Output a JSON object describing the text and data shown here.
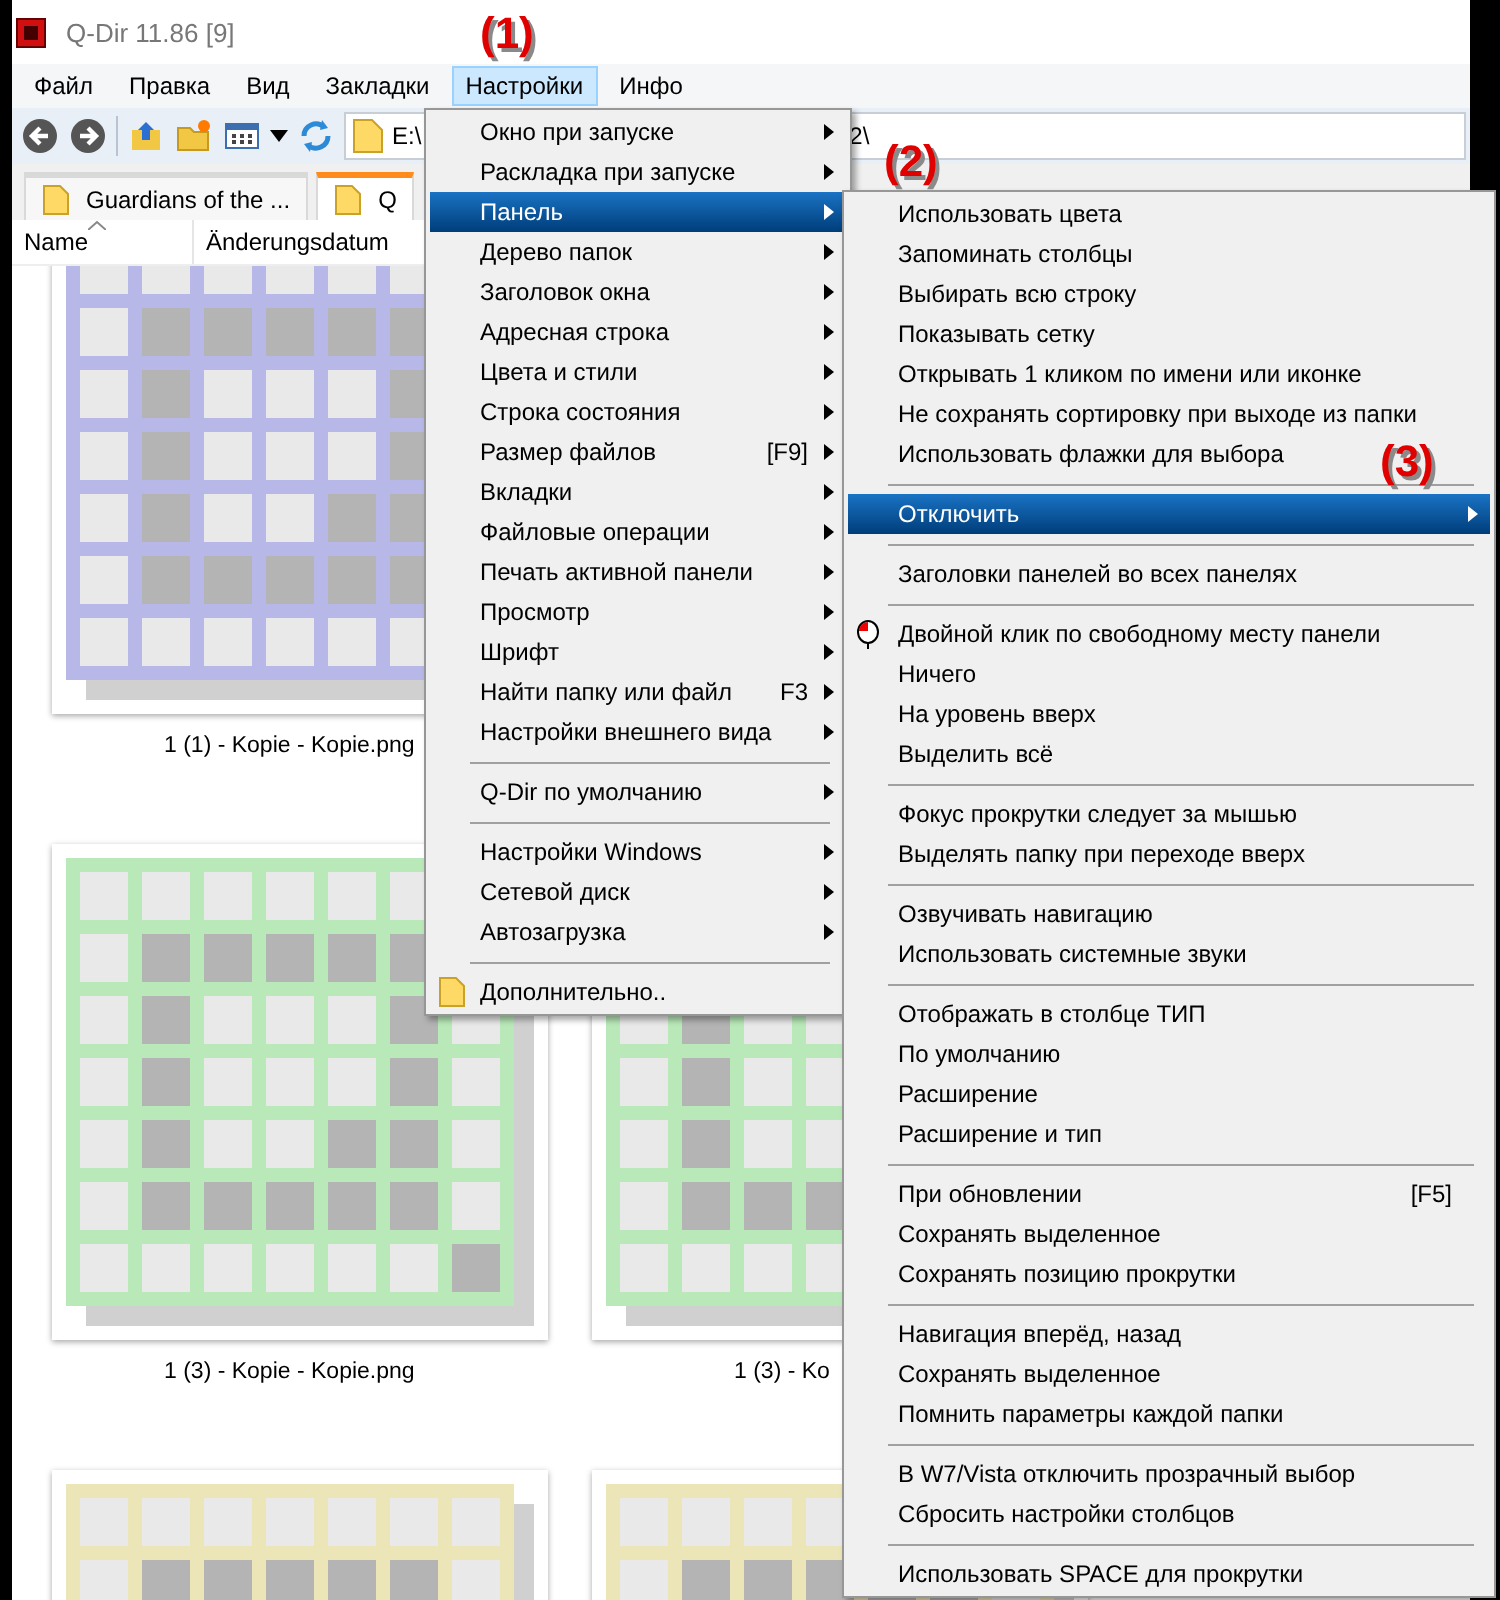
{
  "window": {
    "title": "Q-Dir 11.86 [9]"
  },
  "menu_bar": [
    {
      "label": "Файл",
      "selected": false
    },
    {
      "label": "Правка",
      "selected": false
    },
    {
      "label": "Вид",
      "selected": false
    },
    {
      "label": "Закладки",
      "selected": false
    },
    {
      "label": "Настройки",
      "selected": true
    },
    {
      "label": "Инфо",
      "selected": false
    }
  ],
  "address": {
    "value": "E:\\",
    "tail": "2\\"
  },
  "tabs": [
    {
      "label": "Guardians of the ...",
      "selected": false
    },
    {
      "label": "Q",
      "selected": true
    }
  ],
  "columns": [
    "Name",
    "Änderungsdatum"
  ],
  "thumbnail_rows": [
    [
      {
        "label": "1 (1) - Kopie - Kopie.png",
        "color": "#b8b8e8"
      }
    ],
    [
      {
        "label": "1 (3) - Kopie - Kopie.png",
        "color": "#b9e9b9"
      },
      {
        "label": "1 (3) - Ko",
        "color": "#b9e9b9"
      }
    ],
    [
      {
        "color": "#ebe5b8"
      },
      {
        "color": "#ebe5b8"
      }
    ]
  ],
  "settings_menu": [
    {
      "kind": "submenu",
      "label": "Окно при запуске",
      "selected": false
    },
    {
      "kind": "submenu",
      "label": "Раскладка при запуске",
      "selected": false
    },
    {
      "kind": "submenu",
      "label": "Панель",
      "selected": true
    },
    {
      "kind": "submenu",
      "label": "Дерево папок",
      "selected": false
    },
    {
      "kind": "submenu",
      "label": "Заголовок окна",
      "selected": false
    },
    {
      "kind": "submenu",
      "label": "Адресная строка",
      "selected": false
    },
    {
      "kind": "submenu",
      "label": "Цвета и стили",
      "selected": false
    },
    {
      "kind": "submenu",
      "label": "Строка состояния",
      "selected": false
    },
    {
      "kind": "submenu",
      "label": "Размер файлов",
      "shortcut": "[F9]",
      "selected": false
    },
    {
      "kind": "submenu",
      "label": "Вкладки",
      "selected": false
    },
    {
      "kind": "submenu",
      "label": "Файловые операции",
      "selected": false
    },
    {
      "kind": "submenu",
      "label": "Печать активной панели",
      "selected": false
    },
    {
      "kind": "submenu",
      "label": "Просмотр",
      "selected": false
    },
    {
      "kind": "submenu",
      "label": "Шрифт",
      "selected": false
    },
    {
      "kind": "submenu",
      "label": "Найти папку или файл",
      "shortcut": "F3",
      "selected": false
    },
    {
      "kind": "submenu",
      "label": "Настройки внешнего вида",
      "selected": false
    },
    {
      "kind": "separator"
    },
    {
      "kind": "submenu",
      "label": "Q-Dir по умолчанию",
      "selected": false
    },
    {
      "kind": "separator"
    },
    {
      "kind": "submenu",
      "label": "Настройки Windows",
      "selected": false
    },
    {
      "kind": "submenu",
      "label": "Сетевой диск",
      "selected": false
    },
    {
      "kind": "submenu",
      "label": "Автозагрузка",
      "selected": false
    },
    {
      "kind": "separator"
    },
    {
      "kind": "folder",
      "label": "Дополнительно..",
      "selected": false
    }
  ],
  "panel_menu": [
    {
      "kind": "plain",
      "label": "Использовать цвета",
      "selected": false
    },
    {
      "kind": "plain",
      "label": "Запоминать столбцы",
      "selected": false
    },
    {
      "kind": "plain",
      "label": "Выбирать всю строку",
      "selected": false
    },
    {
      "kind": "plain",
      "label": "Показывать сетку",
      "selected": false
    },
    {
      "kind": "plain",
      "label": "Открывать 1 кликом по имени или иконке",
      "selected": false
    },
    {
      "kind": "plain",
      "label": "Не сохранять сортировку при выходе из папки",
      "selected": false
    },
    {
      "kind": "plain",
      "label": "Использовать флажки для выбора",
      "selected": false
    },
    {
      "kind": "separator"
    },
    {
      "kind": "submenu",
      "label": "Отключить",
      "selected": true
    },
    {
      "kind": "separator"
    },
    {
      "kind": "plain",
      "label": "Заголовки панелей во всех панелях",
      "selected": false
    },
    {
      "kind": "separator"
    },
    {
      "kind": "mouse",
      "label": "Двойной клик по свободному месту панели",
      "selected": false
    },
    {
      "kind": "plain",
      "label": "Ничего",
      "selected": false
    },
    {
      "kind": "plain",
      "label": "На уровень вверх",
      "selected": false
    },
    {
      "kind": "plain",
      "label": "Выделить всё",
      "selected": false
    },
    {
      "kind": "separator"
    },
    {
      "kind": "plain",
      "label": "Фокус прокрутки следует за мышью",
      "selected": false
    },
    {
      "kind": "plain",
      "label": "Выделять папку при переходе вверх",
      "selected": false
    },
    {
      "kind": "separator"
    },
    {
      "kind": "plain",
      "label": "Озвучивать навигацию",
      "selected": false
    },
    {
      "kind": "plain",
      "label": "Использовать системные звуки",
      "selected": false
    },
    {
      "kind": "separator"
    },
    {
      "kind": "plain",
      "label": "Отображать в столбце ТИП",
      "selected": false
    },
    {
      "kind": "plain",
      "label": "По умолчанию",
      "selected": false
    },
    {
      "kind": "plain",
      "label": "Расширение",
      "selected": false
    },
    {
      "kind": "plain",
      "label": "Расширение и тип",
      "selected": false
    },
    {
      "kind": "separator"
    },
    {
      "kind": "plain",
      "label": "При обновлении",
      "shortcut": "[F5]",
      "selected": false
    },
    {
      "kind": "plain",
      "label": "Сохранять выделенное",
      "selected": false
    },
    {
      "kind": "plain",
      "label": "Сохранять позицию прокрутки",
      "selected": false
    },
    {
      "kind": "separator"
    },
    {
      "kind": "plain",
      "label": "Навигация вперёд, назад",
      "selected": false
    },
    {
      "kind": "plain",
      "label": "Сохранять выделенное",
      "selected": false
    },
    {
      "kind": "plain",
      "label": "Помнить параметры каждой папки",
      "selected": false
    },
    {
      "kind": "separator"
    },
    {
      "kind": "plain",
      "label": "В W7/Vista отключить прозрачный выбор",
      "selected": false
    },
    {
      "kind": "plain",
      "label": "Сбросить настройки столбцов",
      "selected": false
    },
    {
      "kind": "separator"
    },
    {
      "kind": "plain",
      "label": "Использовать SPACE для прокрутки",
      "selected": false
    }
  ],
  "annotations": [
    "(1)",
    "(2)",
    "(3)"
  ]
}
